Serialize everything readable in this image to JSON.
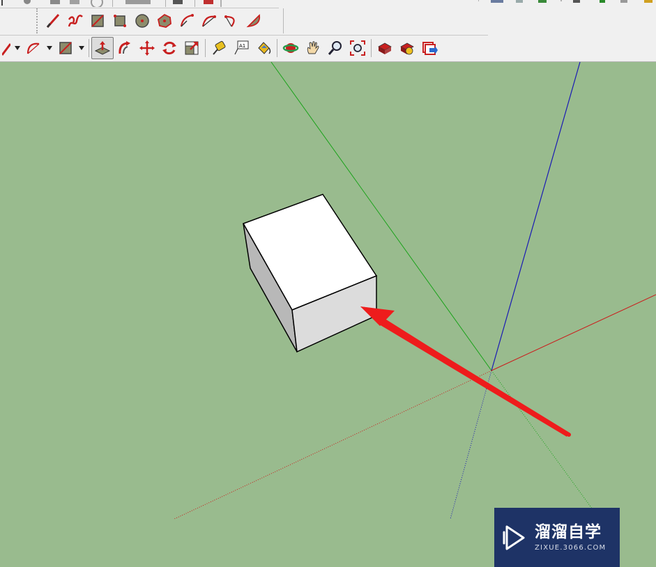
{
  "colors": {
    "canvas": "#99bb8e",
    "toolbar": "#f0f0f0",
    "axis_red": "#cc1a1a",
    "axis_green": "#1aa31a",
    "axis_blue": "#1a1ab4",
    "arrow": "#ee1c1c",
    "watermark_bg": "#1e3366"
  },
  "toolbar_top_partial": {
    "icons": [
      "select-icon",
      "paint-bucket-icon",
      "eraser-icon",
      "walk-icon",
      "look-around-icon",
      "section-icon",
      "components-icon"
    ]
  },
  "toolbar_drawing": {
    "icons": [
      "line-icon",
      "freehand-icon",
      "rectangle-icon",
      "rotated-rectangle-icon",
      "circle-icon",
      "polygon-icon",
      "arc-icon",
      "two-point-arc-icon",
      "three-point-arc-icon",
      "pie-icon"
    ]
  },
  "toolbar_main": {
    "groups": [
      [
        "line-tool-icon",
        "arc-tool-icon",
        "rectangle-tool-icon"
      ],
      [
        "push-pull-icon",
        "follow-me-icon",
        "move-icon",
        "rotate-icon",
        "scale-icon"
      ],
      [
        "tape-measure-icon",
        "text-icon",
        "paint-bucket-icon"
      ],
      [
        "orbit-icon",
        "pan-icon",
        "zoom-icon",
        "zoom-extents-icon"
      ],
      [
        "3d-warehouse-icon",
        "extension-warehouse-icon",
        "send-to-layout-icon"
      ]
    ],
    "active_tool": "push-pull-icon",
    "text_tool_label": "A1"
  },
  "watermark": {
    "title": "溜溜自学",
    "url": "ZIXUE.3066.COM"
  }
}
